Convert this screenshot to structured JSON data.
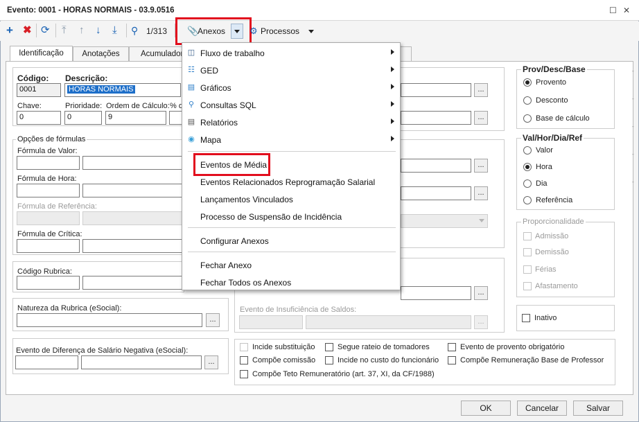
{
  "window": {
    "title": "Evento: 0001 - HORAS NORMAIS - 03.9.0516"
  },
  "toolbar": {
    "counter": "1/313",
    "anexos_label": "Anexos",
    "processos_label": "Processos"
  },
  "tabs": [
    "Identificação",
    "Anotações",
    "Acumulador"
  ],
  "form": {
    "codigo_label": "Código:",
    "codigo_value": "0001",
    "descricao_label": "Descrição:",
    "descricao_value": "HORAS NORMAIS",
    "chave_label": "Chave:",
    "chave_value": "0",
    "prioridade_label": "Prioridade:",
    "prioridade_value": "0",
    "ordem_label": "Ordem de Cálculo:",
    "ordem_value": "9",
    "pct_label": "% d",
    "opcoes_formulas": "Opções de fórmulas",
    "formula_valor": "Fórmula de Valor:",
    "formula_hora": "Fórmula de Hora:",
    "formula_referencia": "Fórmula de Referência:",
    "formula_critica": "Fórmula de Crítica:",
    "codigo_rubrica": "Código Rubrica:",
    "natureza_rubrica": "Natureza da Rubrica (eSocial):",
    "evento_diferenca": "Evento de Diferença de Salário Negativa (eSocial):",
    "evento_insuficiencia": "Evento de Insuficiência de Saldos:",
    "dots": "..."
  },
  "prov": {
    "title": "Prov/Desc/Base",
    "options": [
      "Provento",
      "Desconto",
      "Base de cálculo"
    ],
    "selected": 0
  },
  "val": {
    "title": "Val/Hor/Dia/Ref",
    "options": [
      "Valor",
      "Hora",
      "Dia",
      "Referência"
    ],
    "selected": 1
  },
  "proporcionalidade": {
    "title": "Proporcionalidade",
    "options": [
      "Admissão",
      "Demissão",
      "Férias",
      "Afastamento"
    ]
  },
  "inativo": "Inativo",
  "checks": [
    "Incide substituição",
    "Segue rateio de tomadores",
    "Evento de provento obrigatório",
    "Compõe comissão",
    "Incide no custo do funcionário",
    "Compõe Remuneração Base de Professor",
    "Compõe Teto Remuneratório (art. 37, XI, da CF/1988)"
  ],
  "buttons": {
    "ok": "OK",
    "cancelar": "Cancelar",
    "salvar": "Salvar"
  },
  "menu": {
    "items": [
      {
        "label": "Fluxo de trabalho",
        "icon": "workflow-icon"
      },
      {
        "label": "GED",
        "icon": "ged-icon"
      },
      {
        "label": "Gráficos",
        "icon": "chart-icon"
      },
      {
        "label": "Consultas SQL",
        "icon": "search-icon"
      },
      {
        "label": "Relatórios",
        "icon": "report-icon"
      },
      {
        "label": "Mapa",
        "icon": "map-pin-icon"
      }
    ],
    "plain": [
      "Eventos de Média",
      "Eventos Relacionados Reprogramação Salarial",
      "Lançamentos Vinculados",
      "Processo de Suspensão de Incidência",
      "Configurar Anexos",
      "Fechar Anexo",
      "Fechar Todos os Anexos"
    ]
  },
  "colors": {
    "accent": "#1e6fc9",
    "highlight": "#e20d1d"
  }
}
